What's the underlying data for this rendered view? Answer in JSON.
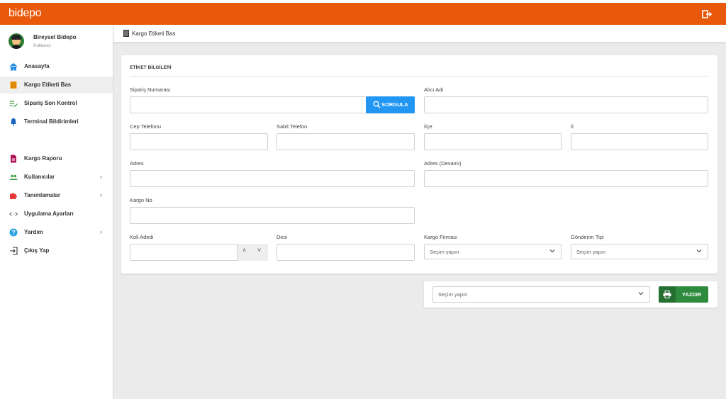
{
  "app": {
    "brand": "bidepo",
    "accent": "#e8590c"
  },
  "user": {
    "name": "Bireysel Bidepo",
    "role": "Kullanıcı"
  },
  "sidebar": {
    "items": [
      {
        "label": "Anasayfa",
        "icon": "home-icon"
      },
      {
        "label": "Kargo Etiketi Bas",
        "icon": "barcode-icon",
        "active": true
      },
      {
        "label": "Sipariş Son Kontrol",
        "icon": "list-check-icon"
      },
      {
        "label": "Terminal Bildirimleri",
        "icon": "bell-icon"
      },
      {
        "label": "Kargo Raporu",
        "icon": "document-icon"
      },
      {
        "label": "Kullanıcılar",
        "icon": "users-icon",
        "has_submenu": true
      },
      {
        "label": "Tanımlamalar",
        "icon": "puzzle-icon",
        "has_submenu": true
      },
      {
        "label": "Uygulama Ayarları",
        "icon": "code-icon"
      },
      {
        "label": "Yardım",
        "icon": "help-icon",
        "has_submenu": true
      },
      {
        "label": "Çıkış Yap",
        "icon": "exit-icon"
      }
    ]
  },
  "breadcrumb": {
    "title": "Kargo Etiketi Bas"
  },
  "form": {
    "section_title": "ETİKET BİLGİLERİ",
    "siparis_no": {
      "label": "Sipariş Numarası",
      "value": ""
    },
    "query_button": "SORGULA",
    "alici_adi": {
      "label": "Alıcı Adı",
      "value": ""
    },
    "cep_tel": {
      "label": "Cep Telefonu",
      "value": ""
    },
    "sabit_tel": {
      "label": "Sabit Telefon",
      "value": ""
    },
    "ilce": {
      "label": "İlçe",
      "value": ""
    },
    "il": {
      "label": "İl",
      "value": ""
    },
    "adres": {
      "label": "Adres",
      "value": ""
    },
    "adres_devami": {
      "label": "Adres (Devamı)",
      "value": ""
    },
    "kargo_no": {
      "label": "Kargo No",
      "value": ""
    },
    "koli_adedi": {
      "label": "Koli Adedi",
      "value": ""
    },
    "desi": {
      "label": "Desi",
      "value": ""
    },
    "kargo_firmasi": {
      "label": "Kargo Firması",
      "selected": "Seçim yapın"
    },
    "gonderim_tipi": {
      "label": "Gönderim Tipi",
      "selected": "Seçim yapın"
    }
  },
  "print": {
    "printer_select": "Seçim yapın",
    "print_button": "YAZDIR",
    "button_color": "#2e8b3e"
  },
  "colors": {
    "query_button": "#2196f3",
    "content_bg": "#ebebeb"
  }
}
